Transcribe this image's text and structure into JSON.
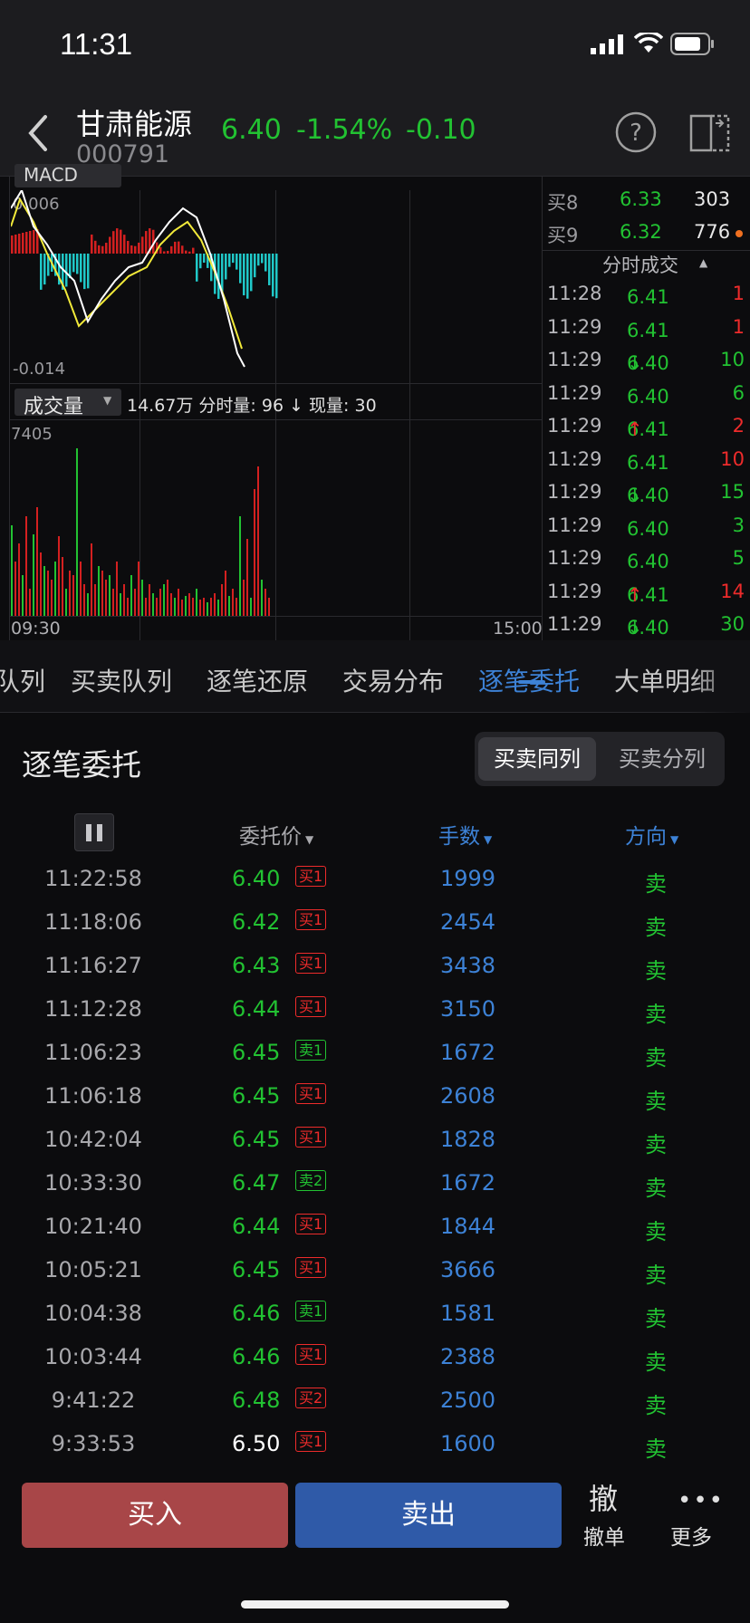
{
  "status": {
    "time": "11:31"
  },
  "header": {
    "name": "甘肃能源",
    "code": "000791",
    "price": "6.40",
    "pct": "-1.54%",
    "change": "-0.10"
  },
  "macd": {
    "label_top": "MACD",
    "top_value": "0.006",
    "bottom_value": "-0.014"
  },
  "volume": {
    "selector_label": "成交量",
    "info": "14.67万 分时量: 96 ↓ 现量: 30",
    "max_value": "7405",
    "time_start": "09:30",
    "time_end": "15:00"
  },
  "order_book": [
    {
      "label": "买8",
      "price": "6.33",
      "qty": "303"
    },
    {
      "label": "买9",
      "price": "6.32",
      "qty": "776"
    }
  ],
  "trades_header": "分时成交",
  "trades": [
    {
      "time": "11:28",
      "price": "6.41",
      "arrow": "",
      "qty": "1",
      "color": "red"
    },
    {
      "time": "11:29",
      "price": "6.41",
      "arrow": "",
      "qty": "1",
      "color": "red"
    },
    {
      "time": "11:29",
      "price": "6.40",
      "arrow": "↓",
      "qty": "10",
      "color": "green"
    },
    {
      "time": "11:29",
      "price": "6.40",
      "arrow": "",
      "qty": "6",
      "color": "green"
    },
    {
      "time": "11:29",
      "price": "6.41",
      "arrow": "↑",
      "qty": "2",
      "color": "red"
    },
    {
      "time": "11:29",
      "price": "6.41",
      "arrow": "",
      "qty": "10",
      "color": "red"
    },
    {
      "time": "11:29",
      "price": "6.40",
      "arrow": "↓",
      "qty": "15",
      "color": "green"
    },
    {
      "time": "11:29",
      "price": "6.40",
      "arrow": "",
      "qty": "3",
      "color": "green"
    },
    {
      "time": "11:29",
      "price": "6.40",
      "arrow": "",
      "qty": "5",
      "color": "green"
    },
    {
      "time": "11:29",
      "price": "6.41",
      "arrow": "↑",
      "qty": "14",
      "color": "red"
    },
    {
      "time": "11:29",
      "price": "6.40",
      "arrow": "↓",
      "qty": "30",
      "color": "green"
    }
  ],
  "tabs": [
    "队列",
    "买卖队列",
    "逐笔还原",
    "交易分布",
    "逐笔委托",
    "大单明细"
  ],
  "active_tab": 4,
  "section": {
    "title": "逐笔委托",
    "toggle_same": "买卖同列",
    "toggle_split": "买卖分列"
  },
  "table_headers": {
    "price": "委托价",
    "qty": "手数",
    "dir": "方向"
  },
  "orders": [
    {
      "time": "11:22:58",
      "price": "6.40",
      "badge": "买1",
      "side": "buy",
      "qty": "1999",
      "dir": "卖",
      "price_color": "green"
    },
    {
      "time": "11:18:06",
      "price": "6.42",
      "badge": "买1",
      "side": "buy",
      "qty": "2454",
      "dir": "卖",
      "price_color": "green"
    },
    {
      "time": "11:16:27",
      "price": "6.43",
      "badge": "买1",
      "side": "buy",
      "qty": "3438",
      "dir": "卖",
      "price_color": "green"
    },
    {
      "time": "11:12:28",
      "price": "6.44",
      "badge": "买1",
      "side": "buy",
      "qty": "3150",
      "dir": "卖",
      "price_color": "green"
    },
    {
      "time": "11:06:23",
      "price": "6.45",
      "badge": "卖1",
      "side": "sell",
      "qty": "1672",
      "dir": "卖",
      "price_color": "green"
    },
    {
      "time": "11:06:18",
      "price": "6.45",
      "badge": "买1",
      "side": "buy",
      "qty": "2608",
      "dir": "卖",
      "price_color": "green"
    },
    {
      "time": "10:42:04",
      "price": "6.45",
      "badge": "买1",
      "side": "buy",
      "qty": "1828",
      "dir": "卖",
      "price_color": "green"
    },
    {
      "time": "10:33:30",
      "price": "6.47",
      "badge": "卖2",
      "side": "sell",
      "qty": "1672",
      "dir": "卖",
      "price_color": "green"
    },
    {
      "time": "10:21:40",
      "price": "6.44",
      "badge": "买1",
      "side": "buy",
      "qty": "1844",
      "dir": "卖",
      "price_color": "green"
    },
    {
      "time": "10:05:21",
      "price": "6.45",
      "badge": "买1",
      "side": "buy",
      "qty": "3666",
      "dir": "卖",
      "price_color": "green"
    },
    {
      "time": "10:04:38",
      "price": "6.46",
      "badge": "卖1",
      "side": "sell",
      "qty": "1581",
      "dir": "卖",
      "price_color": "green"
    },
    {
      "time": "10:03:44",
      "price": "6.46",
      "badge": "买1",
      "side": "buy",
      "qty": "2388",
      "dir": "卖",
      "price_color": "green"
    },
    {
      "time": "9:41:22",
      "price": "6.48",
      "badge": "买2",
      "side": "buy",
      "qty": "2500",
      "dir": "卖",
      "price_color": "green"
    },
    {
      "time": "9:33:53",
      "price": "6.50",
      "badge": "买1",
      "side": "buy",
      "qty": "1600",
      "dir": "卖",
      "price_color": "white"
    }
  ],
  "bottom": {
    "buy": "买入",
    "sell": "卖出",
    "cancel_glyph": "撤",
    "cancel": "撤单",
    "more": "更多"
  },
  "colors": {
    "up": "#ee2b2b",
    "down": "#22c232",
    "accent": "#3d82d6"
  }
}
